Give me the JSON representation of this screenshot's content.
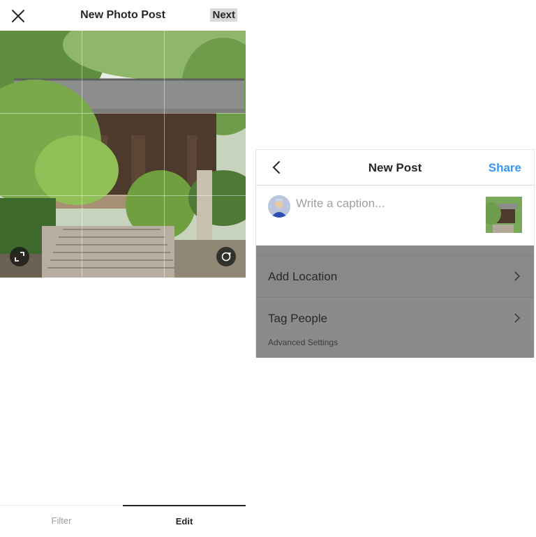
{
  "left_screen": {
    "title": "New Photo Post",
    "close_icon": "close-icon",
    "next_label": "Next",
    "tabs": [
      {
        "label": "Filter",
        "active": false
      },
      {
        "label": "Edit",
        "active": true
      }
    ],
    "expand_icon": "expand-icon",
    "rotate_icon": "rotate-icon"
  },
  "right_screen": {
    "title": "New Post",
    "back_icon": "chevron-left-icon",
    "share_label": "Share",
    "caption_placeholder": "Write a caption...",
    "caption_value": "",
    "rows": [
      {
        "label": "Add Location",
        "icon": "chevron-right-icon"
      },
      {
        "label": "Tag People",
        "icon": "chevron-right-icon"
      }
    ],
    "advanced_label": "Advanced Settings"
  },
  "colors": {
    "accent": "#3897f0",
    "text": "#262626",
    "overlay": "#8a8a8a"
  }
}
